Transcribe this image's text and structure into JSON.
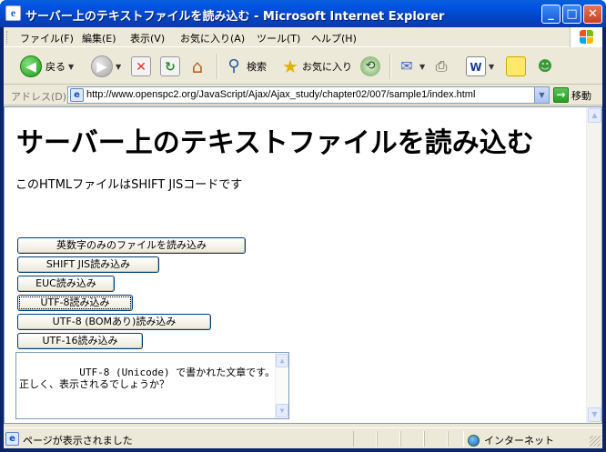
{
  "window": {
    "title": "サーバー上のテキストファイルを読み込む - Microsoft Internet Explorer",
    "min_glyph": "_",
    "max_glyph": "□",
    "close_glyph": "✕"
  },
  "menu": {
    "items": [
      "ファイル(F)",
      "編集(E)",
      "表示(V)",
      "お気に入り(A)",
      "ツール(T)",
      "ヘルプ(H)"
    ]
  },
  "toolbar": {
    "back_label": "戻る",
    "search_label": "検索",
    "favorites_label": "お気に入り"
  },
  "address": {
    "label": "アドレス(D)",
    "url": "http://www.openspc2.org/JavaScript/Ajax/Ajax_study/chapter02/007/sample1/index.html",
    "go_label": "移動"
  },
  "page": {
    "heading": "サーバー上のテキストファイルを読み込む",
    "subtitle": "このHTMLファイルはSHIFT JISコードです",
    "buttons": [
      "英数字のみのファイルを読み込み",
      "SHIFT JIS読み込み",
      "EUC読み込み",
      "UTF-8読み込み",
      "UTF-8 (BOMあり)読み込み",
      "UTF-16読み込み"
    ],
    "result_text": "UTF-8 (Unicode) で書かれた文章です。\n正しく、表示されるでしょうか？"
  },
  "status": {
    "text": "ページが表示されました",
    "zone": "インターネット"
  },
  "colors": {
    "titlebar": "#0055e5",
    "chrome": "#ece9d8",
    "close_button": "#c9401f"
  }
}
